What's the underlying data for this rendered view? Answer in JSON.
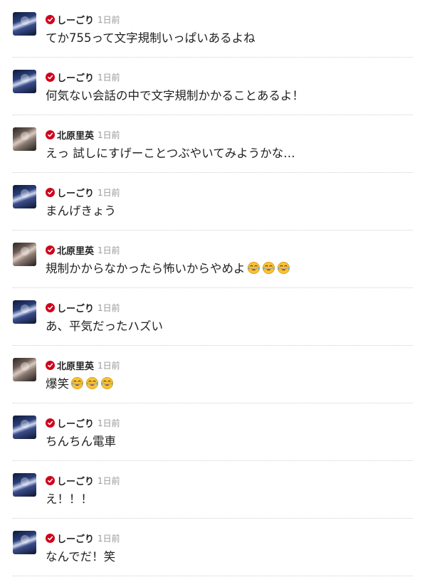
{
  "posts": [
    {
      "user": "しーごり",
      "avatar": "male",
      "time": "1日前",
      "text": "てか755って文字規制いっぱいあるよね",
      "emoji_count": 0
    },
    {
      "user": "しーごり",
      "avatar": "male",
      "time": "1日前",
      "text": "何気ない会話の中で文字規制かかることあるよ！",
      "emoji_count": 0
    },
    {
      "user": "北原里英",
      "avatar": "female",
      "time": "1日前",
      "text": "えっ 試しにすげーことつぶやいてみようかな…",
      "emoji_count": 0
    },
    {
      "user": "しーごり",
      "avatar": "male",
      "time": "1日前",
      "text": "まんげきょう",
      "emoji_count": 0
    },
    {
      "user": "北原里英",
      "avatar": "female",
      "time": "1日前",
      "text": "規制かからなかったら怖いからやめよ",
      "emoji_count": 3
    },
    {
      "user": "しーごり",
      "avatar": "male",
      "time": "1日前",
      "text": "あ、平気だったハズい",
      "emoji_count": 0
    },
    {
      "user": "北原里英",
      "avatar": "female",
      "time": "1日前",
      "text": "爆笑",
      "emoji_count": 3
    },
    {
      "user": "しーごり",
      "avatar": "male",
      "time": "1日前",
      "text": "ちんちん電車",
      "emoji_count": 0
    },
    {
      "user": "しーごり",
      "avatar": "male",
      "time": "1日前",
      "text": "え！！！",
      "emoji_count": 0
    },
    {
      "user": "しーごり",
      "avatar": "male",
      "time": "1日前",
      "text": "なんでだ！笑",
      "emoji_count": 0
    }
  ],
  "icons": {
    "verified": "verified-check-icon",
    "emoji": "tears-of-joy-emoji-icon"
  },
  "colors": {
    "verified_badge": "#d0021b",
    "time_text": "#9a9a9a",
    "divider": "#cfcfcf"
  }
}
